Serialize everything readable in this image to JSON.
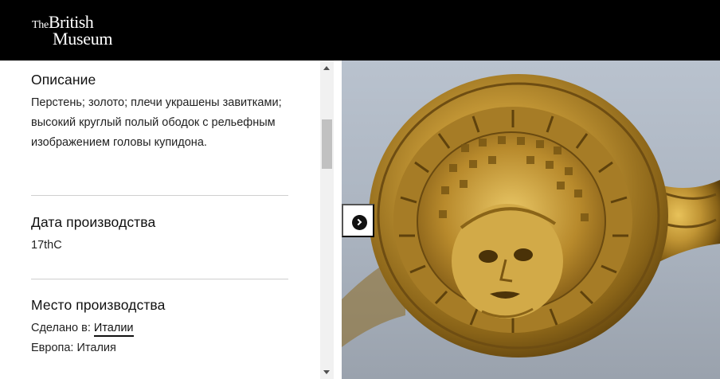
{
  "header": {
    "logo_the": "The",
    "logo_british": "British",
    "logo_museum": "Museum"
  },
  "description": {
    "title": "Описание",
    "text": "Перстень; золото; плечи украшены завитками; высокий круглый полый ободок с рельефным изображением головы купидона."
  },
  "production_date": {
    "title": "Дата производства",
    "value": "17thC"
  },
  "production_place": {
    "title": "Место производства",
    "made_in_label": "Сделано в:",
    "made_in_link": "Италии",
    "region_line": "Европа: Италия"
  },
  "image": {
    "subject": "gold ring with cupid head"
  },
  "icons": {
    "next": "chevron-right-icon",
    "scroll_up": "scroll-up-arrow-icon",
    "scroll_down": "scroll-down-arrow-icon"
  },
  "colors": {
    "header_bg": "#000000",
    "text": "#1a1a1a",
    "gold": "#b8902e"
  }
}
